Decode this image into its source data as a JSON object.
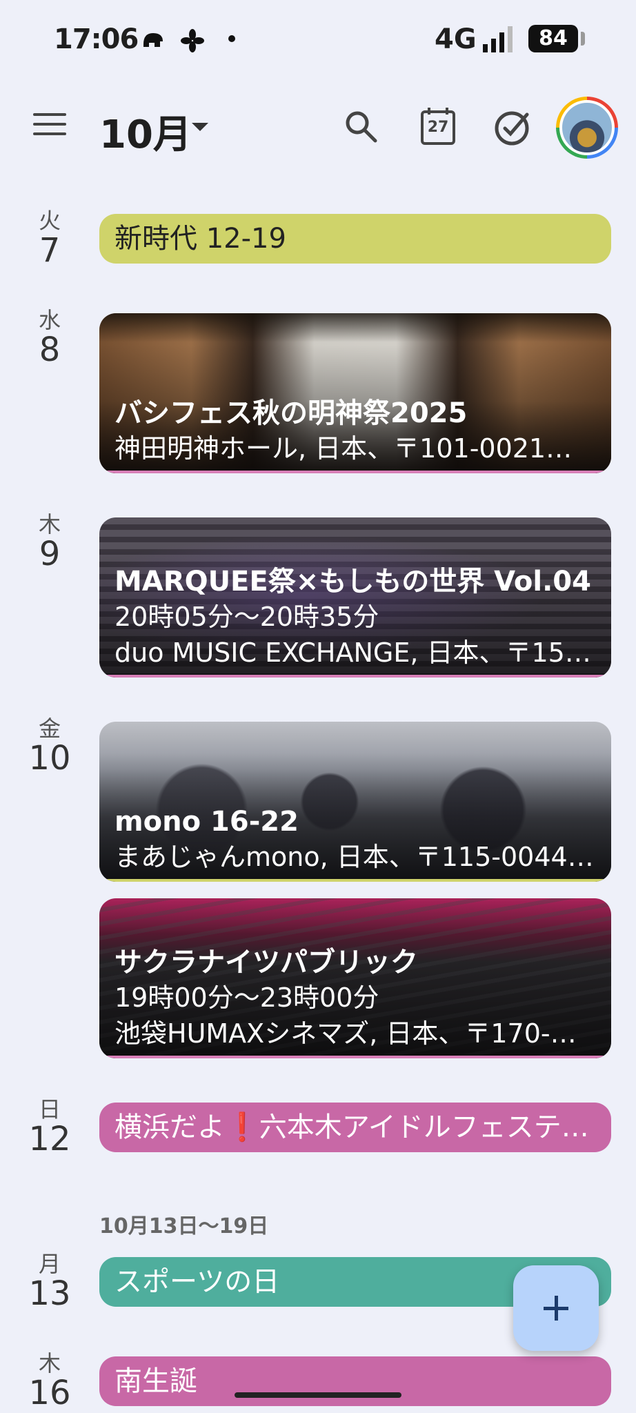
{
  "status_bar": {
    "time": "17:06",
    "network": "4G",
    "battery": "84"
  },
  "app_bar": {
    "month_title": "10月",
    "calendar_icon_day": "27"
  },
  "days": [
    {
      "dow": "火",
      "num": "7"
    },
    {
      "dow": "水",
      "num": "8"
    },
    {
      "dow": "木",
      "num": "9"
    },
    {
      "dow": "金",
      "num": "10"
    },
    {
      "dow": "日",
      "num": "12"
    },
    {
      "dow": "月",
      "num": "13"
    },
    {
      "dow": "木",
      "num": "16"
    }
  ],
  "events": {
    "e7": {
      "title": "新時代 12-19",
      "color": "#cfd36a"
    },
    "e8": {
      "title": "バシフェス秋の明神祭2025",
      "location": "神田明神ホール, 日本、〒101-0021…",
      "edge": "#d87fb8"
    },
    "e9": {
      "title": "MARQUEE祭×もしもの世界 Vol.04",
      "time": "20時05分～20時35分",
      "location": "duo MUSIC EXCHANGE, 日本、〒15…",
      "edge": "#d87fb8"
    },
    "e10a": {
      "title": "mono 16-22",
      "location": "まあじゃんmono, 日本、〒115-0044…",
      "edge": "#cfd36a"
    },
    "e10b": {
      "title": "サクラナイツパブリック",
      "time": "19時00分～23時00分",
      "location": "池袋HUMAXシネマズ, 日本、〒170-…",
      "edge": "#d87fb8"
    },
    "e12": {
      "title": "横浜だよ❗六本木アイドルフェステ…",
      "color": "#c868a6"
    },
    "e13": {
      "title": "スポーツの日",
      "color": "#4fae9d"
    },
    "e16": {
      "title": "南生誕",
      "color": "#c868a6"
    }
  },
  "week_label": "10月13日～19日"
}
